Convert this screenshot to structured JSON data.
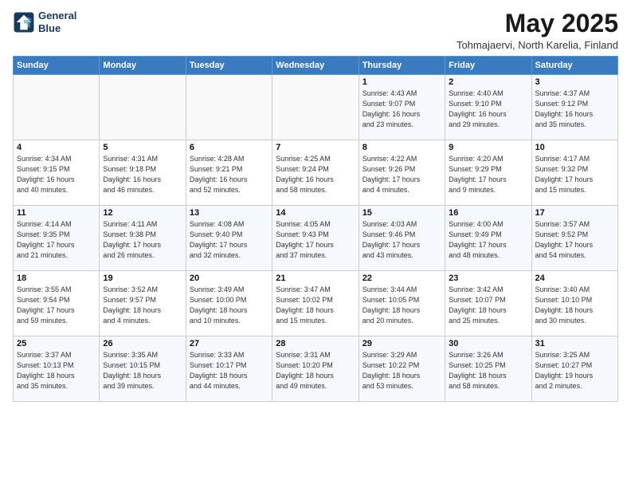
{
  "logo": {
    "line1": "General",
    "line2": "Blue"
  },
  "title": "May 2025",
  "location": "Tohmajaervi, North Karelia, Finland",
  "days_of_week": [
    "Sunday",
    "Monday",
    "Tuesday",
    "Wednesday",
    "Thursday",
    "Friday",
    "Saturday"
  ],
  "weeks": [
    [
      {
        "day": "",
        "info": ""
      },
      {
        "day": "",
        "info": ""
      },
      {
        "day": "",
        "info": ""
      },
      {
        "day": "",
        "info": ""
      },
      {
        "day": "1",
        "info": "Sunrise: 4:43 AM\nSunset: 9:07 PM\nDaylight: 16 hours\nand 23 minutes."
      },
      {
        "day": "2",
        "info": "Sunrise: 4:40 AM\nSunset: 9:10 PM\nDaylight: 16 hours\nand 29 minutes."
      },
      {
        "day": "3",
        "info": "Sunrise: 4:37 AM\nSunset: 9:12 PM\nDaylight: 16 hours\nand 35 minutes."
      }
    ],
    [
      {
        "day": "4",
        "info": "Sunrise: 4:34 AM\nSunset: 9:15 PM\nDaylight: 16 hours\nand 40 minutes."
      },
      {
        "day": "5",
        "info": "Sunrise: 4:31 AM\nSunset: 9:18 PM\nDaylight: 16 hours\nand 46 minutes."
      },
      {
        "day": "6",
        "info": "Sunrise: 4:28 AM\nSunset: 9:21 PM\nDaylight: 16 hours\nand 52 minutes."
      },
      {
        "day": "7",
        "info": "Sunrise: 4:25 AM\nSunset: 9:24 PM\nDaylight: 16 hours\nand 58 minutes."
      },
      {
        "day": "8",
        "info": "Sunrise: 4:22 AM\nSunset: 9:26 PM\nDaylight: 17 hours\nand 4 minutes."
      },
      {
        "day": "9",
        "info": "Sunrise: 4:20 AM\nSunset: 9:29 PM\nDaylight: 17 hours\nand 9 minutes."
      },
      {
        "day": "10",
        "info": "Sunrise: 4:17 AM\nSunset: 9:32 PM\nDaylight: 17 hours\nand 15 minutes."
      }
    ],
    [
      {
        "day": "11",
        "info": "Sunrise: 4:14 AM\nSunset: 9:35 PM\nDaylight: 17 hours\nand 21 minutes."
      },
      {
        "day": "12",
        "info": "Sunrise: 4:11 AM\nSunset: 9:38 PM\nDaylight: 17 hours\nand 26 minutes."
      },
      {
        "day": "13",
        "info": "Sunrise: 4:08 AM\nSunset: 9:40 PM\nDaylight: 17 hours\nand 32 minutes."
      },
      {
        "day": "14",
        "info": "Sunrise: 4:05 AM\nSunset: 9:43 PM\nDaylight: 17 hours\nand 37 minutes."
      },
      {
        "day": "15",
        "info": "Sunrise: 4:03 AM\nSunset: 9:46 PM\nDaylight: 17 hours\nand 43 minutes."
      },
      {
        "day": "16",
        "info": "Sunrise: 4:00 AM\nSunset: 9:49 PM\nDaylight: 17 hours\nand 48 minutes."
      },
      {
        "day": "17",
        "info": "Sunrise: 3:57 AM\nSunset: 9:52 PM\nDaylight: 17 hours\nand 54 minutes."
      }
    ],
    [
      {
        "day": "18",
        "info": "Sunrise: 3:55 AM\nSunset: 9:54 PM\nDaylight: 17 hours\nand 59 minutes."
      },
      {
        "day": "19",
        "info": "Sunrise: 3:52 AM\nSunset: 9:57 PM\nDaylight: 18 hours\nand 4 minutes."
      },
      {
        "day": "20",
        "info": "Sunrise: 3:49 AM\nSunset: 10:00 PM\nDaylight: 18 hours\nand 10 minutes."
      },
      {
        "day": "21",
        "info": "Sunrise: 3:47 AM\nSunset: 10:02 PM\nDaylight: 18 hours\nand 15 minutes."
      },
      {
        "day": "22",
        "info": "Sunrise: 3:44 AM\nSunset: 10:05 PM\nDaylight: 18 hours\nand 20 minutes."
      },
      {
        "day": "23",
        "info": "Sunrise: 3:42 AM\nSunset: 10:07 PM\nDaylight: 18 hours\nand 25 minutes."
      },
      {
        "day": "24",
        "info": "Sunrise: 3:40 AM\nSunset: 10:10 PM\nDaylight: 18 hours\nand 30 minutes."
      }
    ],
    [
      {
        "day": "25",
        "info": "Sunrise: 3:37 AM\nSunset: 10:13 PM\nDaylight: 18 hours\nand 35 minutes."
      },
      {
        "day": "26",
        "info": "Sunrise: 3:35 AM\nSunset: 10:15 PM\nDaylight: 18 hours\nand 39 minutes."
      },
      {
        "day": "27",
        "info": "Sunrise: 3:33 AM\nSunset: 10:17 PM\nDaylight: 18 hours\nand 44 minutes."
      },
      {
        "day": "28",
        "info": "Sunrise: 3:31 AM\nSunset: 10:20 PM\nDaylight: 18 hours\nand 49 minutes."
      },
      {
        "day": "29",
        "info": "Sunrise: 3:29 AM\nSunset: 10:22 PM\nDaylight: 18 hours\nand 53 minutes."
      },
      {
        "day": "30",
        "info": "Sunrise: 3:26 AM\nSunset: 10:25 PM\nDaylight: 18 hours\nand 58 minutes."
      },
      {
        "day": "31",
        "info": "Sunrise: 3:25 AM\nSunset: 10:27 PM\nDaylight: 19 hours\nand 2 minutes."
      }
    ]
  ]
}
